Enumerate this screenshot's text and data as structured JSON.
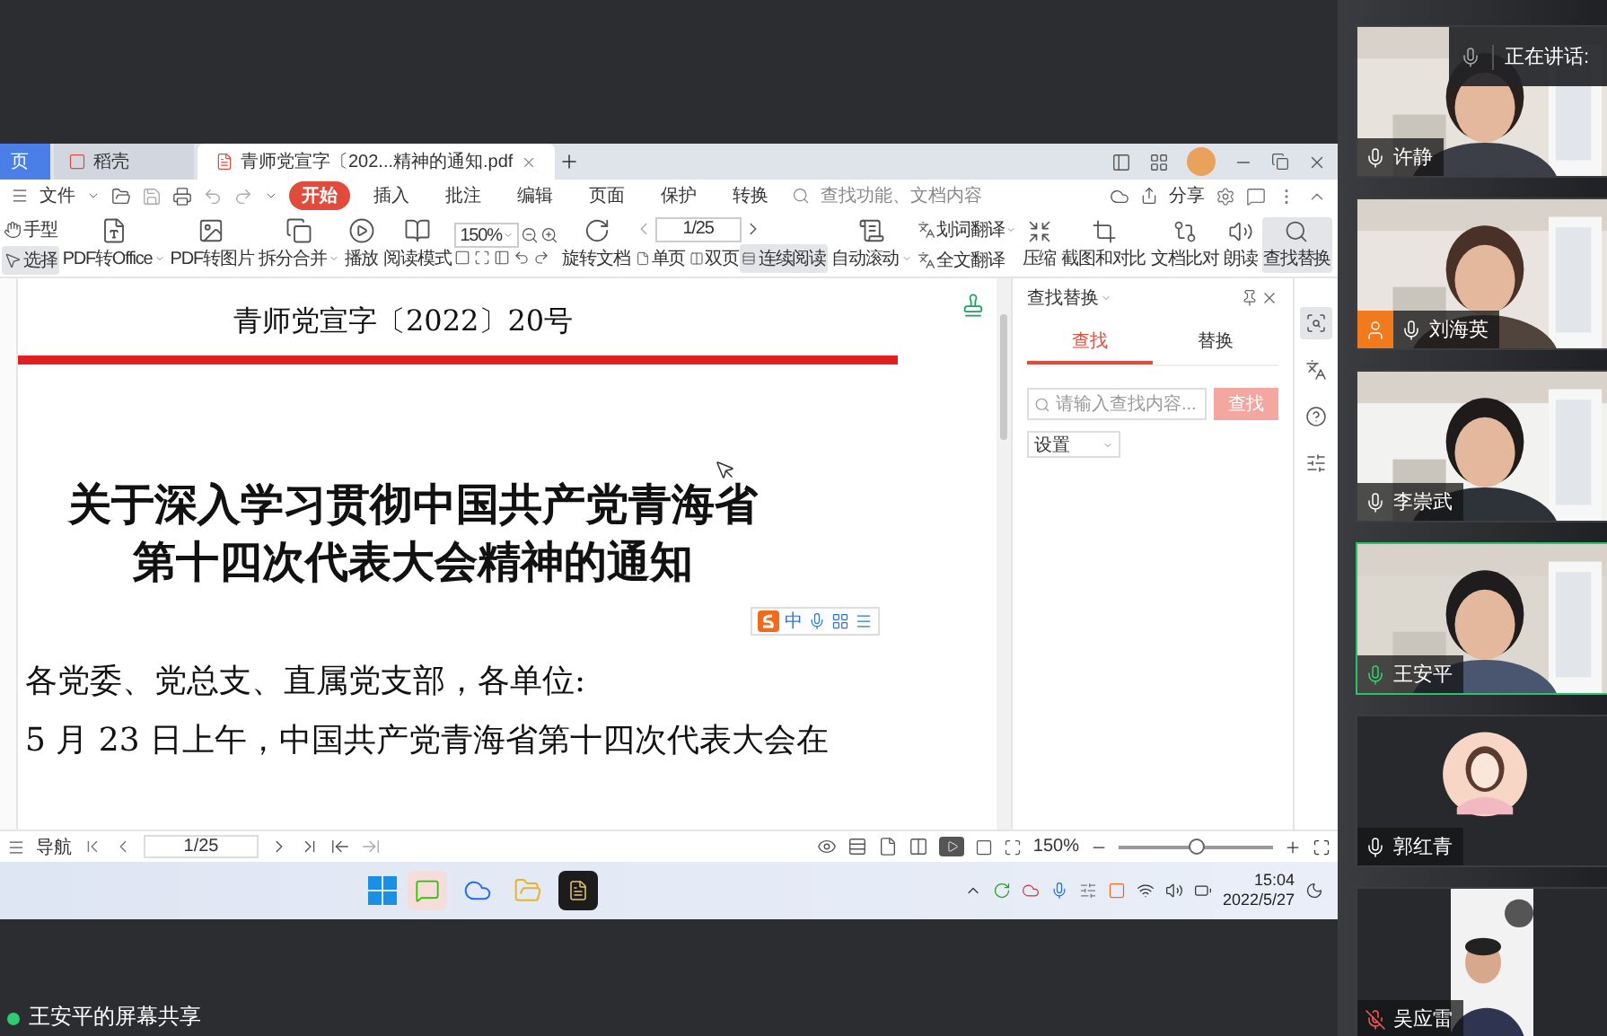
{
  "meeting": {
    "speaking_label": "正在讲话:",
    "screen_share_label": "王安平的屏幕共享"
  },
  "app": {
    "tabs": [
      {
        "label": "页",
        "kind": "home",
        "selected": false
      },
      {
        "label": "稻壳",
        "kind": "docer",
        "selected": false
      },
      {
        "label": "青师党宣字〔202...精神的通知.pdf",
        "kind": "pdf",
        "selected": true
      }
    ],
    "file_menu": "文件",
    "menu": [
      {
        "label": "开始",
        "selected": true
      },
      {
        "label": "插入",
        "selected": false
      },
      {
        "label": "批注",
        "selected": false
      },
      {
        "label": "编辑",
        "selected": false
      },
      {
        "label": "页面",
        "selected": false
      },
      {
        "label": "保护",
        "selected": false
      },
      {
        "label": "转换",
        "selected": false
      }
    ],
    "search_placeholder": "查找功能、文档内容",
    "share": "分享",
    "ribbon": {
      "pointer_tools": [
        {
          "label": "手型",
          "selected": false
        },
        {
          "label": "选择",
          "selected": true
        }
      ],
      "buttons": [
        {
          "label": "PDF转Office",
          "dropdown": true
        },
        {
          "label": "PDF转图片",
          "dropdown": false
        },
        {
          "label": "拆分合并",
          "dropdown": true
        },
        {
          "label": "播放",
          "dropdown": false
        },
        {
          "label": "阅读模式",
          "dropdown": false
        }
      ],
      "zoom": "150%",
      "rotate": "旋转文档",
      "page": "1/25",
      "view_modes": [
        {
          "label": "单页",
          "selected": false
        },
        {
          "label": "双页",
          "selected": false
        },
        {
          "label": "连续阅读",
          "selected": true
        }
      ],
      "auto_scroll": "自动滚动",
      "translate": [
        {
          "label": "划词翻译",
          "dropdown": true
        },
        {
          "label": "全文翻译",
          "dropdown": false
        }
      ],
      "tools": [
        {
          "label": "压缩",
          "selected": false
        },
        {
          "label": "截图和对比",
          "selected": false
        },
        {
          "label": "文档比对",
          "selected": false
        },
        {
          "label": "朗读",
          "selected": false
        },
        {
          "label": "查找替换",
          "selected": true
        }
      ]
    },
    "document": {
      "doc_number": "青师党宣字〔2022〕20号",
      "title_lines": [
        "关于深入学习贯彻中国共产党青海省",
        "第十四次代表大会精神的通知"
      ],
      "body_lines": [
        "各党委、党总支、直属党支部，各单位:",
        "5 月 23 日上午，中国共产党青海省第十四次代表大会在"
      ]
    },
    "ime_bar": {
      "mode": "中"
    },
    "find_panel": {
      "title": "查找替换",
      "tabs": [
        {
          "label": "查找",
          "selected": true
        },
        {
          "label": "替换",
          "selected": false
        }
      ],
      "placeholder": "请输入查找内容...",
      "button": "查找",
      "option": "设置"
    },
    "status_bar": {
      "nav": "导航",
      "page": "1/25",
      "zoom": "150%",
      "zoom_slider": {
        "level": 0.5
      }
    }
  },
  "taskbar": {
    "time": "15:04",
    "date": "2022/5/27"
  },
  "participants": [
    {
      "name": "许静",
      "muted": false,
      "speaking": false,
      "kind": "camera",
      "presenter": false,
      "active": false
    },
    {
      "name": "刘海英",
      "muted": false,
      "speaking": false,
      "kind": "camera",
      "presenter": true,
      "active": false
    },
    {
      "name": "李崇武",
      "muted": false,
      "speaking": false,
      "kind": "camera",
      "presenter": false,
      "active": false
    },
    {
      "name": "王安平",
      "muted": false,
      "speaking": true,
      "kind": "camera",
      "presenter": false,
      "active": true
    },
    {
      "name": "郭红青",
      "muted": false,
      "speaking": false,
      "kind": "avatar",
      "presenter": false,
      "active": false
    },
    {
      "name": "吴应雷",
      "muted": true,
      "speaking": false,
      "kind": "portrait",
      "presenter": false,
      "active": false
    }
  ]
}
